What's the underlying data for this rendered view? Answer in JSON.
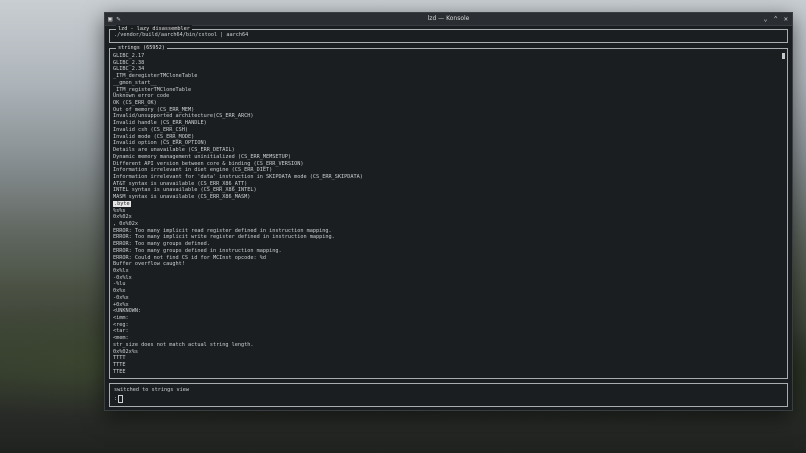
{
  "window": {
    "title": "lzd — Konsole",
    "controls": [
      "minimize-icon",
      "maximize-icon",
      "close-icon"
    ]
  },
  "app": {
    "panel_title": "lzd - lazy disassembler",
    "binary_path": "./vendor/build/aarch64/bin/cstool | aarch64"
  },
  "strings": {
    "panel_title": "strings (65952)",
    "selected_index": 22,
    "items": [
      "GLIBC_2.17",
      "GLIBC_2.38",
      "GLIBC_2.34",
      "_ITM_deregisterTMCloneTable",
      "__gmon_start__",
      "_ITM_registerTMCloneTable",
      "Unknown error code",
      "OK (CS_ERR_OK)",
      "Out of memory (CS_ERR_MEM)",
      "Invalid/unsupported architecture(CS_ERR_ARCH)",
      "Invalid handle (CS_ERR_HANDLE)",
      "Invalid csh (CS_ERR_CSH)",
      "Invalid mode (CS_ERR_MODE)",
      "Invalid option (CS_ERR_OPTION)",
      "Details are unavailable (CS_ERR_DETAIL)",
      "Dynamic memory management uninitialized (CS_ERR_MEMSETUP)",
      "Different API version between core & binding (CS_ERR_VERSION)",
      "Information irrelevant in diet engine (CS_ERR_DIET)",
      "Information irrelevant for 'data' instruction in SKIPDATA mode (CS_ERR_SKIPDATA)",
      "AT&T syntax is unavailable (CS_ERR_X86_ATT)",
      "INTEL syntax is unavailable (CS_ERR_X86_INTEL)",
      "MASM syntax is unavailable (CS_ERR_X86_MASM)",
      ".byte",
      "%s%s",
      "0x%02x",
      ", 0x%02x",
      "ERROR: Too many implicit read register defined in instruction mapping.",
      "ERROR: Too many implicit write register defined in instruction mapping.",
      "ERROR: Too many groups defined.",
      "ERROR: Too many groups defined in instruction mapping.",
      "ERROR: Could not find CS id for MCInst opcode: %d",
      "Buffer overflow caught!",
      "0x%lx",
      "-0x%lx",
      "-%lu",
      "0x%x",
      "-0x%x",
      "+0x%x",
      "<UNKNOWN:",
      "<imm:",
      "<reg:",
      "<tar:",
      "<mem:",
      "str_size does not match actual string length.",
      "0x%02x%s",
      "TTTT",
      "TTTE",
      "TTEE"
    ]
  },
  "status": {
    "message": "switched to strings view",
    "prompt": ":"
  }
}
